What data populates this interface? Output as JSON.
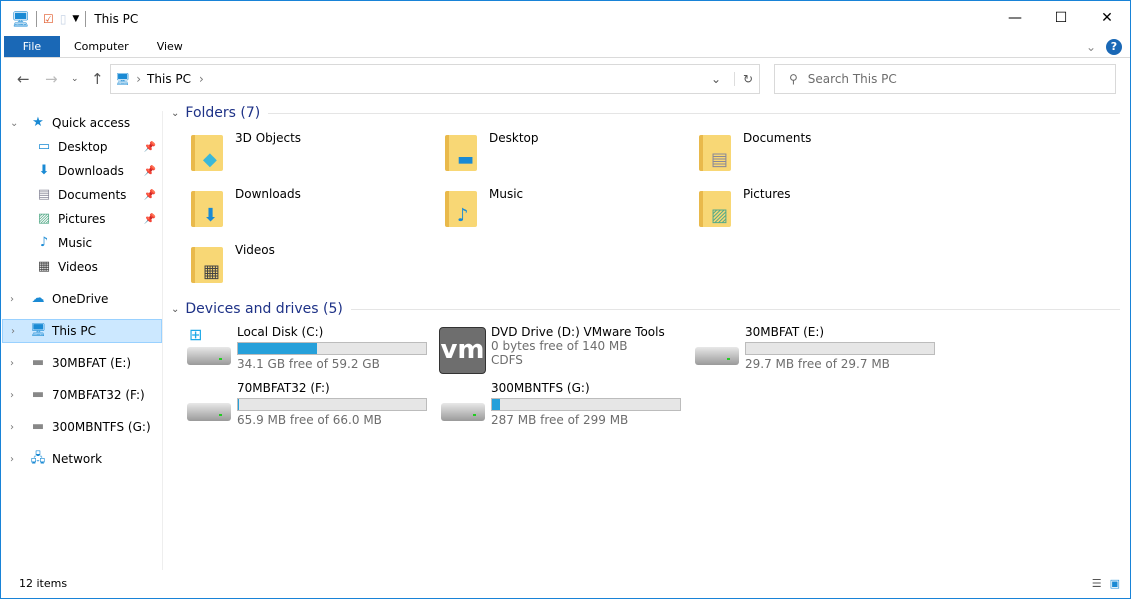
{
  "window": {
    "title": "This PC"
  },
  "ribbon": {
    "tabs": [
      "File",
      "Computer",
      "View"
    ],
    "help": "?"
  },
  "address": {
    "path": "This PC",
    "search_placeholder": "Search This PC"
  },
  "nav": {
    "quick_access": "Quick access",
    "quick_items": [
      "Desktop",
      "Downloads",
      "Documents",
      "Pictures",
      "Music",
      "Videos"
    ],
    "onedrive": "OneDrive",
    "this_pc": "This PC",
    "drives": [
      "30MBFAT (E:)",
      "70MBFAT32 (F:)",
      "300MBNTFS (G:)"
    ],
    "network": "Network"
  },
  "folders": {
    "header": "Folders (7)",
    "items": [
      "3D Objects",
      "Desktop",
      "Documents",
      "Downloads",
      "Music",
      "Pictures",
      "Videos"
    ]
  },
  "devices": {
    "header": "Devices and drives (5)",
    "items": [
      {
        "name": "Local Disk (C:)",
        "free": "34.1 GB free of 59.2 GB",
        "used_fraction": 0.42
      },
      {
        "name": "DVD Drive (D:) VMware Tools",
        "free": "0 bytes free of 140 MB",
        "fs": "CDFS",
        "logo": "vm"
      },
      {
        "name": "30MBFAT (E:)",
        "free": "29.7 MB free of 29.7 MB",
        "used_fraction": 0
      },
      {
        "name": "70MBFAT32 (F:)",
        "free": "65.9 MB free of 66.0 MB",
        "used_fraction": 0.002
      },
      {
        "name": "300MBNTFS (G:)",
        "free": "287 MB free of 299 MB",
        "used_fraction": 0.04
      }
    ]
  },
  "status": {
    "items": "12 items"
  },
  "colors": {
    "accent": "#1a68b6",
    "bar": "#26a0da"
  }
}
